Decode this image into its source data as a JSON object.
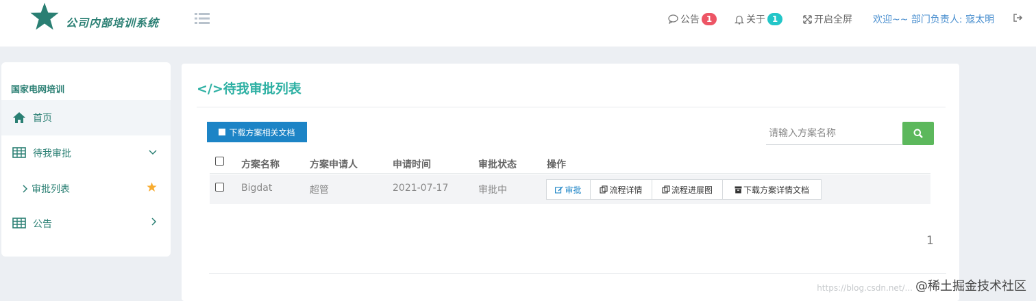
{
  "app": {
    "name": "公司内部培训系统"
  },
  "header": {
    "notice_label": "公告",
    "notice_count": "1",
    "about_label": "关于",
    "about_count": "1",
    "fullscreen_label": "开启全屏",
    "welcome_text": "欢迎~~ 部门负责人: 寇太明"
  },
  "sidebar": {
    "section_title": "国家电网培训",
    "items": [
      {
        "label": "首页"
      },
      {
        "label": "待我审批"
      },
      {
        "label": "审批列表"
      },
      {
        "label": "公告"
      }
    ]
  },
  "main": {
    "title": "</>待我审批列表",
    "download_button": "下载方案相关文档",
    "search_placeholder": "请输入方案名称",
    "table": {
      "headers": [
        "方案名称",
        "方案申请人",
        "申请时间",
        "审批状态",
        "操作"
      ],
      "rows": [
        {
          "name": "Bigdat",
          "applicant": "超管",
          "date": "2021-07-17",
          "status": "审批中"
        }
      ],
      "actions": [
        "审批",
        "流程详情",
        "流程进展图",
        "下载方案详情文档"
      ]
    },
    "pagination": "1"
  },
  "watermark": {
    "url_text": "https://blog.csdn.net/...",
    "text": "@稀土掘金技术社区"
  },
  "colors": {
    "brand_teal": "#2a7f73",
    "title_teal": "#2db0a3",
    "primary_blue": "#1c84c6",
    "search_green": "#5cb85c",
    "badge_red": "#ed5565",
    "badge_teal": "#23c6c8"
  },
  "icons": {
    "logo": "star-icon",
    "menu_toggle": "list-icon",
    "notice": "comment-icon",
    "about": "bell-icon",
    "fullscreen": "arrows-expand-icon",
    "logout": "sign-out-icon",
    "home": "home-icon",
    "table": "table-icon",
    "chevron_down": "chevron-down-icon",
    "chevron_right": "chevron-right-icon",
    "favorite": "star-icon",
    "search": "search-icon"
  }
}
